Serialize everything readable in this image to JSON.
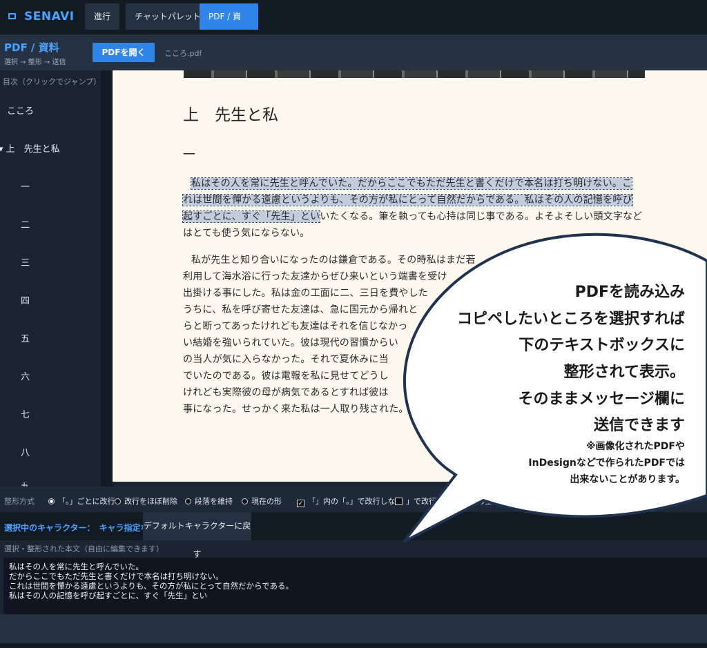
{
  "nav": {
    "brand": "SENAVI",
    "tabs": [
      {
        "label": "進行"
      },
      {
        "label": "チャットパレット"
      },
      {
        "label": "PDF / 資料"
      }
    ]
  },
  "subheader": {
    "title": "PDF / 資料",
    "hint": "選択 → 整形 → 送信",
    "open_button": "PDFを開く",
    "file_name": "こころ.pdf"
  },
  "sidebar": {
    "label": "目次（クリックでジャンプ）",
    "items": [
      {
        "label": "こころ"
      },
      {
        "label": "▾ 上　先生と私"
      },
      {
        "label": "一"
      },
      {
        "label": "二"
      },
      {
        "label": "三"
      },
      {
        "label": "四"
      },
      {
        "label": "五"
      },
      {
        "label": "六"
      },
      {
        "label": "七"
      },
      {
        "label": "八"
      },
      {
        "label": "九"
      }
    ]
  },
  "pdf": {
    "chapter": "上　先生と私",
    "section": "一",
    "lines": [
      {
        "sel": "私はその人を常に先生と呼んでいた。だからここでもただ先生と書くだけで本名は打ち明けない。こ",
        "rest": ""
      },
      {
        "sel": "れは世間を憚かる遠慮というよりも、その方が私にとって自然だからである。私はその人の記憶を呼び",
        "rest": ""
      },
      {
        "sel": "起すごとに、すぐ「先生」とい",
        "rest": "いたくなる。筆を執っても心持は同じ事である。よそよそしい頭文字など"
      },
      {
        "sel": "",
        "rest": "はとても使う気にならない。"
      },
      {
        "sel": "",
        "rest": "私が先生と知り合いになったのは鎌倉である。その時私はまだ若"
      },
      {
        "sel": "",
        "rest": "利用して海水浴に行った友達からぜひ来いという端書を受け"
      },
      {
        "sel": "",
        "rest": "出掛ける事にした。私は金の工面に二、三日を費やした"
      },
      {
        "sel": "",
        "rest": "うちに、私を呼び寄せた友達は、急に国元から帰れと"
      },
      {
        "sel": "",
        "rest": "らと断ってあったけれども友達はそれを信じなかっ"
      },
      {
        "sel": "",
        "rest": "い結婚を強いられていた。彼は現代の習慣からい"
      },
      {
        "sel": "",
        "rest": "の当人が気に入らなかった。それで夏休みに当"
      },
      {
        "sel": "",
        "rest": "でいたのである。彼は電報を私に見せてどうし"
      },
      {
        "sel": "",
        "rest": "けれども実際彼の母が病気であるとすれば彼は"
      },
      {
        "sel": "",
        "rest": "事になった。せっかく来た私は一人取り残された。"
      }
    ]
  },
  "options": {
    "label": "整形方式",
    "radios": [
      {
        "label": "「。」ごとに改行",
        "selected": true
      },
      {
        "label": "改行をほぼ削除",
        "selected": false
      },
      {
        "label": "段落を維持",
        "selected": false
      },
      {
        "label": "現在の形",
        "selected": false
      }
    ],
    "checks": [
      {
        "label": "「」内の「。」で改行しない",
        "checked": true
      },
      {
        "label": "」で改行",
        "checked": false
      }
    ],
    "cut_text": "間の空白"
  },
  "character": {
    "label": "選択中のキャラクター：　キャラ指定なし",
    "reset_button": "デフォルトキャラクターに戻す"
  },
  "text_area": {
    "label": "選択・整形された本文（自由に編集できます）",
    "value": "私はその人を常に先生と呼んでいた。\nだからここでもただ先生と書くだけで本名は打ち明けない。\nこれは世間を憚かる遠慮というよりも、その方が私にとって自然だからである。\n私はその人の記憶を呼び起すごとに、すぐ「先生」とい"
  },
  "callout": {
    "lines": [
      "PDFを読み込み",
      "コピペしたいところを選択すれば",
      "下のテキストボックスに",
      "整形されて表示。",
      "そのままメッセージ欄に",
      "送信できます"
    ],
    "notes": [
      "※画像化されたPDFや",
      "InDesignなどで作られたPDFでは",
      "出来ないことがあります。"
    ],
    "colors": {
      "fill": "#ffffff",
      "stroke": "#1f3350"
    }
  }
}
